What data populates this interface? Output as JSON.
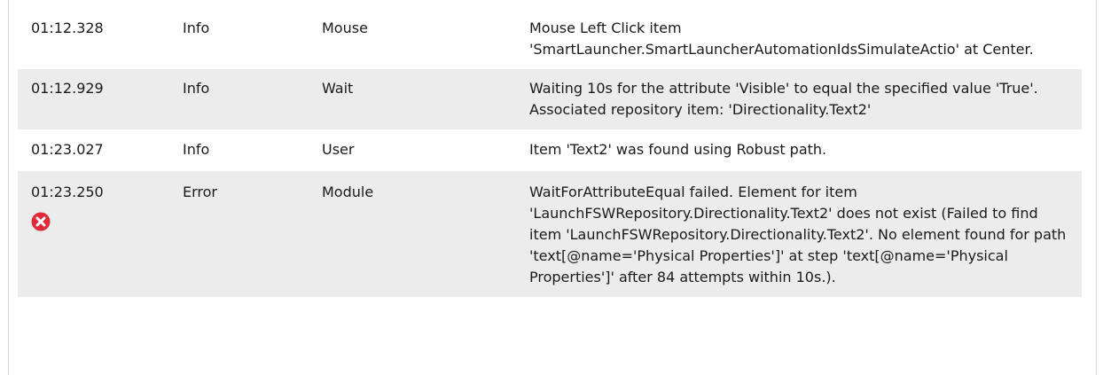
{
  "log_rows": [
    {
      "time": "01:12.328",
      "level": "Info",
      "category": "Mouse",
      "message": "Mouse Left Click item 'SmartLauncher.SmartLauncherAutomationIdsSimulateActio' at Center."
    },
    {
      "time": "01:12.929",
      "level": "Info",
      "category": "Wait",
      "message": "Waiting 10s for the attribute 'Visible' to equal the specified value 'True'. Associated repository item: 'Directionality.Text2'"
    },
    {
      "time": "01:23.027",
      "level": "Info",
      "category": "User",
      "message": "Item 'Text2' was found using Robust path."
    },
    {
      "time": "01:23.250",
      "level": "Error",
      "category": "Module",
      "message": "WaitForAttributeEqual failed. Element for item 'LaunchFSWRepository.Directionality.Text2' does not exist (Failed to find item 'LaunchFSWRepository.Directionality.Text2'. No element found for path 'text[@name='Physical Properties']' at step 'text[@name='Physical Properties']' after 84 attempts within 10s.).",
      "icon": "error-icon"
    }
  ],
  "colors": {
    "row_alt": "#ececec",
    "error_icon": "#e0293b"
  }
}
